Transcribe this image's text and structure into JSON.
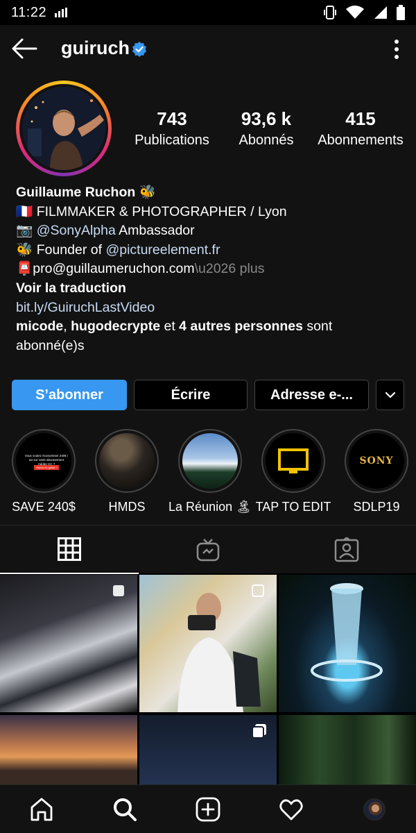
{
  "status_bar": {
    "time": "11:22"
  },
  "header": {
    "username": "guiruch"
  },
  "stats": [
    {
      "value": "743",
      "label": "Publications"
    },
    {
      "value": "93,6 k",
      "label": "Abonnés"
    },
    {
      "value": "415",
      "label": "Abonnements"
    }
  ],
  "bio": {
    "name": "Guillaume Ruchon",
    "name_emoji": "🐝",
    "line1_flag": "🇫🇷",
    "line1": " FILMMAKER & PHOTOGRAPHER / Lyon",
    "line2_icon": "📷",
    "line2_link": "@SonyAlpha",
    "line2_rest": " Ambassador",
    "line3_icon": "🐝",
    "line3_text": " Founder of ",
    "line3_link": "@pictureelement.fr",
    "line4_icon": "📮",
    "line4_text": "pro@guillaumeruchon.com",
    "line4_more": "\\u2026 plus",
    "translate": "Voir la traduction",
    "website": "bit.ly/GuiruchLastVideo",
    "followed_by_1": "micode",
    "followed_by_sep": ", ",
    "followed_by_2": "hugodecrypte",
    "followed_by_mid": " et ",
    "followed_by_others": "4 autres personnes",
    "followed_by_end": " sont abonné(e)s"
  },
  "buttons": {
    "follow": "S’abonner",
    "message": "Écrire",
    "email": "Adresse e-...",
    "colors": {
      "follow_bg": "#3897f0"
    }
  },
  "highlights": [
    {
      "label": "SAVE 240$",
      "inner_text_1": "Vous voulez économiser 240€ / an sur votre abonnement Adobe CC ?",
      "inner_text_2": "Suivez le guide !"
    },
    {
      "label": "HMDS"
    },
    {
      "label": "La Réunion 🏝"
    },
    {
      "label": "TAP TO EDIT"
    },
    {
      "label": "SDLP19",
      "inner_text_1": "SONY"
    }
  ],
  "tabs": [
    {
      "name": "grid",
      "icon": "grid-icon",
      "active": true
    },
    {
      "name": "igtv",
      "icon": "igtv-icon",
      "active": false
    },
    {
      "name": "tagged",
      "icon": "tagged-icon",
      "active": false
    }
  ],
  "bottom_nav": [
    "home-icon",
    "search-icon",
    "add-post-icon",
    "heart-icon",
    "profile-avatar"
  ]
}
